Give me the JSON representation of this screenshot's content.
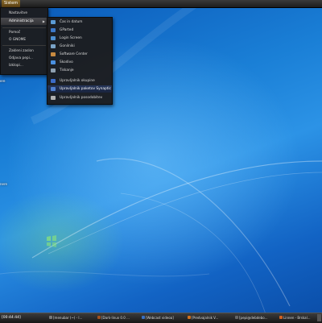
{
  "top_panel": {
    "system_button": "Sistem"
  },
  "system_menu": {
    "items": [
      "Nastavitve",
      "Administracija",
      "Pomoč",
      "O GNOME",
      "Zakleni zaslon",
      "Odjava pepi...",
      "Izklopi..."
    ],
    "active_index": 1
  },
  "admin_menu": {
    "items": [
      {
        "label": "Čas in datum",
        "icon": "clock-icon",
        "color": "#5b9bd5"
      },
      {
        "label": "GParted",
        "icon": "disk-icon",
        "color": "#3c78c8"
      },
      {
        "label": "Login Screen",
        "icon": "login-icon",
        "color": "#4d8fd0"
      },
      {
        "label": "Gonilniki",
        "icon": "hardware-icon",
        "color": "#7aa4c8"
      },
      {
        "label": "Software Center",
        "icon": "store-icon",
        "color": "#c88a40"
      },
      {
        "label": "Skodivo",
        "icon": "folder-icon",
        "color": "#4a90e0"
      },
      {
        "label": "Tiskanje",
        "icon": "printer-icon",
        "color": "#8ea0b0"
      },
      {
        "label": "Upravljalnik okupine",
        "icon": "group-icon",
        "color": "#3c6cc8"
      },
      {
        "label": "Upravljalnik paketov Synaptic",
        "icon": "synaptic-icon",
        "color": "#5080d0"
      },
      {
        "label": "Upravljalnik posodobitev",
        "icon": "update-icon",
        "color": "#b0b0b0"
      }
    ],
    "highlight_index": 8
  },
  "desktop_labels": [
    "ere",
    "nere"
  ],
  "taskbar": {
    "clock": "[00:44:44]",
    "tasks": [
      {
        "label": "[menubar (~) - l...",
        "color": "#777"
      },
      {
        "label": "[Dark-linux 0.0 ...",
        "color": "#a05020"
      },
      {
        "label": "[Webcast videoa]",
        "color": "#3a70c0"
      },
      {
        "label": "[Predvajalnik V...",
        "color": "#d07020"
      },
      {
        "label": "[pepi@debdebo...",
        "color": "#666"
      },
      {
        "label": "Linnen - Brskal...",
        "color": "#d06020"
      }
    ]
  },
  "colors": {
    "wallpaper": "#1a7fd6",
    "system_button": "#7a5a1f",
    "highlight": "#1e2b48"
  }
}
